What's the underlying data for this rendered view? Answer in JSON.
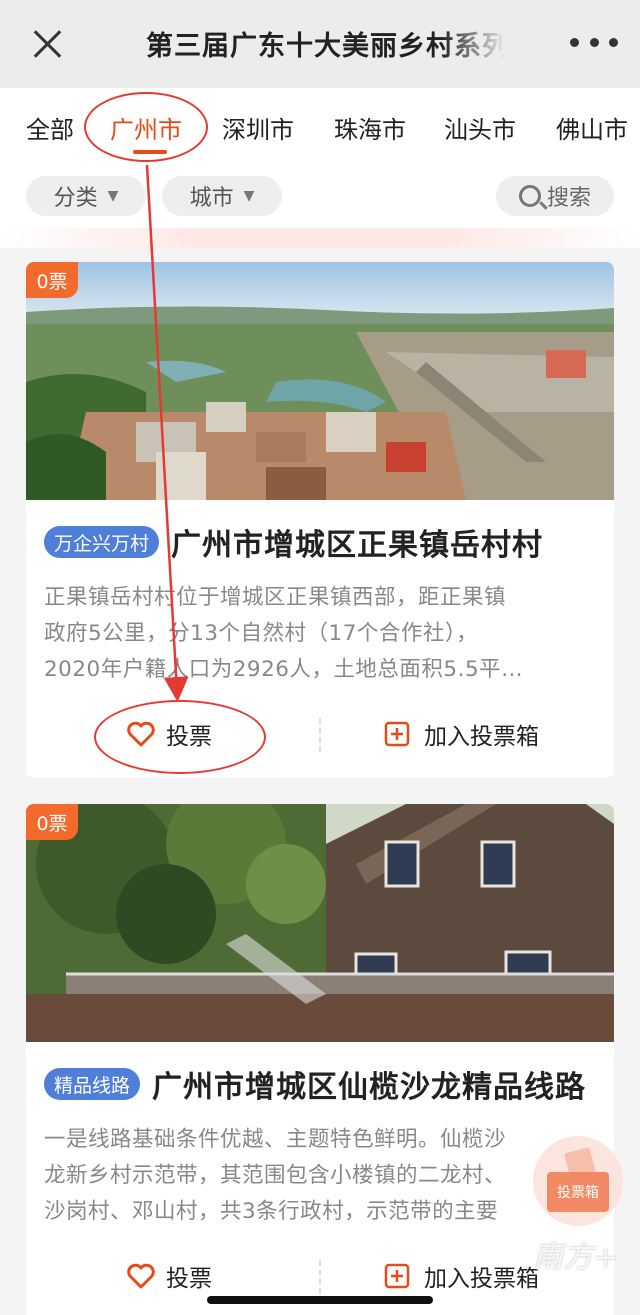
{
  "header": {
    "title": "第三届广东十大美丽乡村系列"
  },
  "tabs": [
    {
      "label": "全部",
      "active": false
    },
    {
      "label": "广州市",
      "active": true
    },
    {
      "label": "深圳市",
      "active": false
    },
    {
      "label": "珠海市",
      "active": false
    },
    {
      "label": "汕头市",
      "active": false
    },
    {
      "label": "佛山市",
      "active": false
    }
  ],
  "filters": {
    "category": "分类",
    "city": "城市",
    "search": "搜索"
  },
  "cards": [
    {
      "votes": "0票",
      "tag": "万企兴万村",
      "name": "广州市增城区正果镇岳村村",
      "desc_lines": [
        "正果镇岳村村位于增城区正果镇西部，距正果镇",
        "政府5公里，分13个自然村（17个合作社），",
        "2020年户籍人口为2926人，土地总面积5.5平…"
      ],
      "vote_label": "投票",
      "addbox_label": "加入投票箱"
    },
    {
      "votes": "0票",
      "tag": "精品线路",
      "name": "广州市增城区仙榄沙龙精品线路",
      "desc_lines": [
        "一是线路基础条件优越、主题特色鲜明。仙榄沙",
        "龙新乡村示范带，其范围包含小楼镇的二龙村、",
        "沙岗村、邓山村，共3条行政村，示范带的主要"
      ],
      "vote_label": "投票",
      "addbox_label": "加入投票箱"
    }
  ],
  "floating": {
    "ballot_label": "投票箱"
  },
  "watermark": "南方+",
  "colors": {
    "accent": "#e64a19",
    "tag": "#4f7fd9",
    "badge": "#f26a2c"
  }
}
